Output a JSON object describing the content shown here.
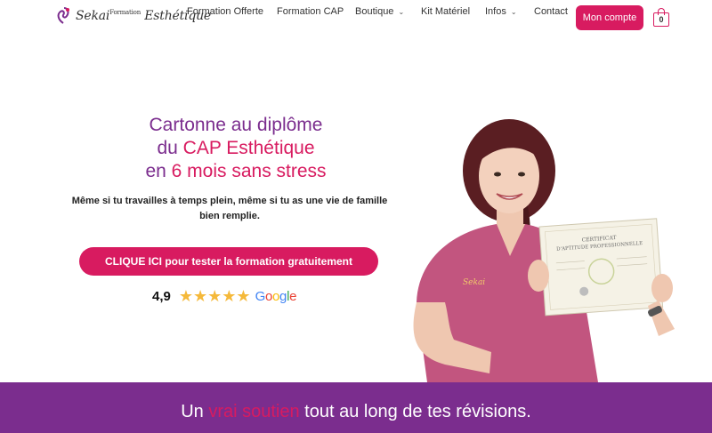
{
  "header": {
    "logo": {
      "name": "Sekai",
      "sup": "Formation",
      "script": "Esthétique"
    },
    "nav": [
      {
        "label": "Formation Offerte",
        "chevron": false
      },
      {
        "label": "Formation CAP",
        "chevron": false
      },
      {
        "label": "Boutique",
        "chevron": true
      },
      {
        "label": "Kit Matériel",
        "chevron": false
      },
      {
        "label": "Infos",
        "chevron": true
      },
      {
        "label": "Contact",
        "chevron": false
      }
    ],
    "account_label": "Mon compte",
    "cart_count": "0"
  },
  "hero": {
    "title_line1": "Cartonne au diplôme",
    "title_line2_pre": "du ",
    "title_line2_hl": "CAP Esthétique",
    "title_line3_pre": "en ",
    "title_line3_hl": "6 mois sans stress",
    "subtitle": "Même si tu travailles à temps plein, même si tu as une vie de famille bien remplie.",
    "cta_label": "CLIQUE ICI pour tester la formation gratuitement",
    "rating_value": "4,9",
    "rating_stars": 5,
    "google_label": "Google"
  },
  "photo": {
    "certificate_line1": "CERTIFICAT",
    "certificate_line2": "D'APTITUDE PROFESSIONNELLE",
    "uniform_name": "Sekai"
  },
  "banner": {
    "pre": "Un ",
    "highlight": "vrai soutien",
    "post": " tout au long de tes révisions."
  },
  "colors": {
    "brand_pink": "#d81b60",
    "brand_purple": "#7b2d8e",
    "star": "#f5b93a"
  },
  "icons": [
    "chevron-down-icon",
    "cart-icon",
    "star-icon",
    "logo-mark-icon"
  ]
}
